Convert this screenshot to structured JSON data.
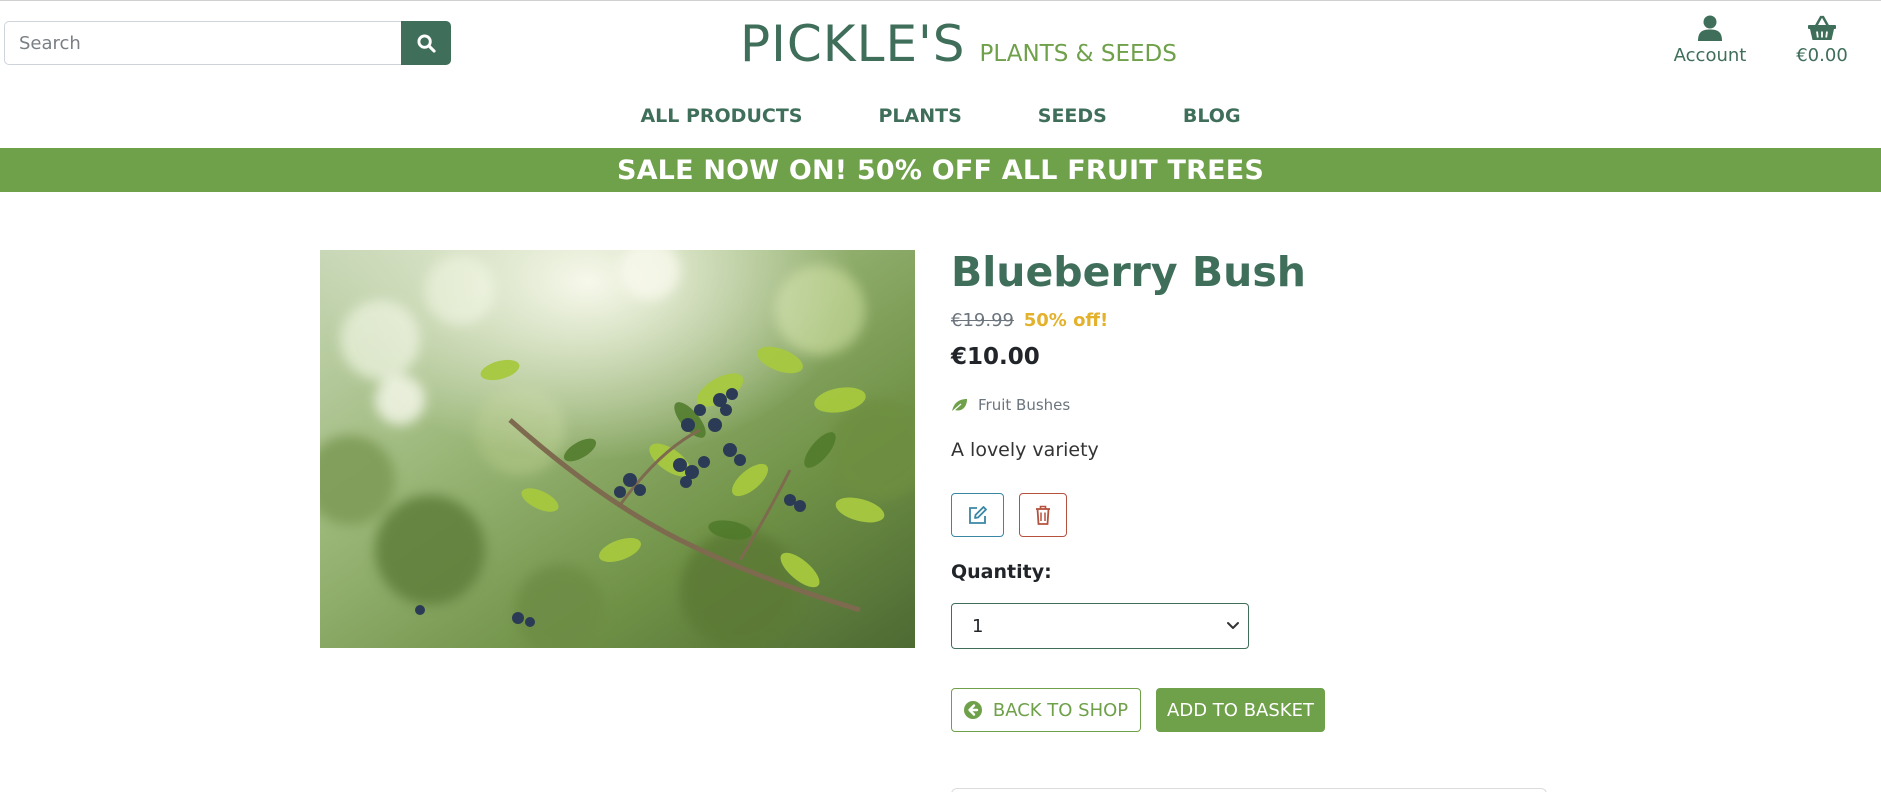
{
  "header": {
    "search_placeholder": "Search",
    "brand_main": "PICKLE'S",
    "brand_sub": "PLANTS & SEEDS",
    "account_label": "Account",
    "basket_total": "€0.00"
  },
  "nav": [
    {
      "label": "ALL PRODUCTS"
    },
    {
      "label": "PLANTS"
    },
    {
      "label": "SEEDS"
    },
    {
      "label": "BLOG"
    }
  ],
  "banner": "SALE NOW ON! 50% OFF ALL FRUIT TREES",
  "product": {
    "name": "Blueberry Bush",
    "original_price": "€19.99",
    "discount": "50% off!",
    "price": "€10.00",
    "category": "Fruit Bushes",
    "description": "A lovely variety",
    "quantity_label": "Quantity:",
    "quantity_value": "1",
    "back_label": "BACK TO SHOP",
    "add_label": "ADD TO BASKET"
  },
  "icons": {
    "search": "search-icon",
    "account": "user-icon",
    "basket": "basket-icon",
    "category": "leaf-icon",
    "edit": "edit-icon",
    "delete": "trash-icon",
    "back": "arrow-circle-left-icon",
    "select": "chevron-down-icon"
  },
  "colors": {
    "brand_dark": "#3f6e5a",
    "brand_green": "#6fa04a",
    "discount_yellow": "#e3b12b",
    "edit_blue": "#3a87a4",
    "delete_red": "#b5523f"
  }
}
